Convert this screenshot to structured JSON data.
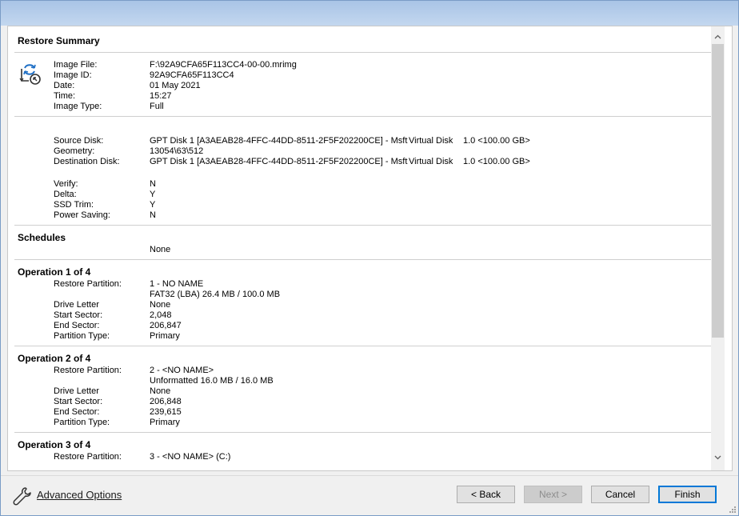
{
  "summary": {
    "title": "Restore Summary",
    "image_info": [
      {
        "label": "Image File:",
        "value": "F:\\92A9CFA65F113CC4-00-00.mrimg"
      },
      {
        "label": "Image ID:",
        "value": "92A9CFA65F113CC4"
      },
      {
        "label": "Date:",
        "value": "01 May 2021"
      },
      {
        "label": "Time:",
        "value": "15:27"
      },
      {
        "label": "Image Type:",
        "value": "Full"
      }
    ],
    "disk_info": {
      "source_label": "Source Disk:",
      "source_value": "GPT Disk 1 [A3AEAB28-4FFC-44DD-8511-2F5F202200CE] - Msft",
      "source_model": "Virtual Disk",
      "source_size": "1.0  <100.00 GB>",
      "geometry_label": "Geometry:",
      "geometry_value": "13054\\63\\512",
      "dest_label": "Destination Disk:",
      "dest_value": "GPT Disk 1 [A3AEAB28-4FFC-44DD-8511-2F5F202200CE] - Msft",
      "dest_model": "Virtual Disk",
      "dest_size": "1.0  <100.00 GB>"
    },
    "options": [
      {
        "label": "Verify:",
        "value": "N"
      },
      {
        "label": "Delta:",
        "value": "Y"
      },
      {
        "label": "SSD Trim:",
        "value": "Y"
      },
      {
        "label": "Power Saving:",
        "value": "N"
      }
    ]
  },
  "schedules": {
    "title": "Schedules",
    "value": "None"
  },
  "operations": [
    {
      "title": "Operation 1 of 4",
      "restore_partition_label": "Restore Partition:",
      "restore_partition_value": "1 - NO NAME",
      "fs_info": "FAT32 (LBA) 26.4 MB / 100.0 MB",
      "drive_letter_label": "Drive Letter",
      "drive_letter_value": "None",
      "start_sector_label": "Start Sector:",
      "start_sector_value": "2,048",
      "end_sector_label": "End Sector:",
      "end_sector_value": "206,847",
      "partition_type_label": "Partition Type:",
      "partition_type_value": "Primary"
    },
    {
      "title": "Operation 2 of 4",
      "restore_partition_label": "Restore Partition:",
      "restore_partition_value": "2 - <NO NAME>",
      "fs_info": "Unformatted 16.0 MB / 16.0 MB",
      "drive_letter_label": "Drive Letter",
      "drive_letter_value": "None",
      "start_sector_label": "Start Sector:",
      "start_sector_value": "206,848",
      "end_sector_label": "End Sector:",
      "end_sector_value": "239,615",
      "partition_type_label": "Partition Type:",
      "partition_type_value": "Primary"
    },
    {
      "title": "Operation 3 of 4",
      "restore_partition_label": "Restore Partition:",
      "restore_partition_value": "3 - <NO NAME> (C:)"
    }
  ],
  "footer": {
    "advanced_options": "Advanced Options",
    "back": "< Back",
    "next": "Next >",
    "cancel": "Cancel",
    "finish": "Finish"
  },
  "icons": {
    "restore": "restore-image-icon",
    "advanced": "wrench-icon"
  },
  "colors": {
    "primary_button_border": "#0078d7",
    "title_bar": "#b7cdea"
  }
}
